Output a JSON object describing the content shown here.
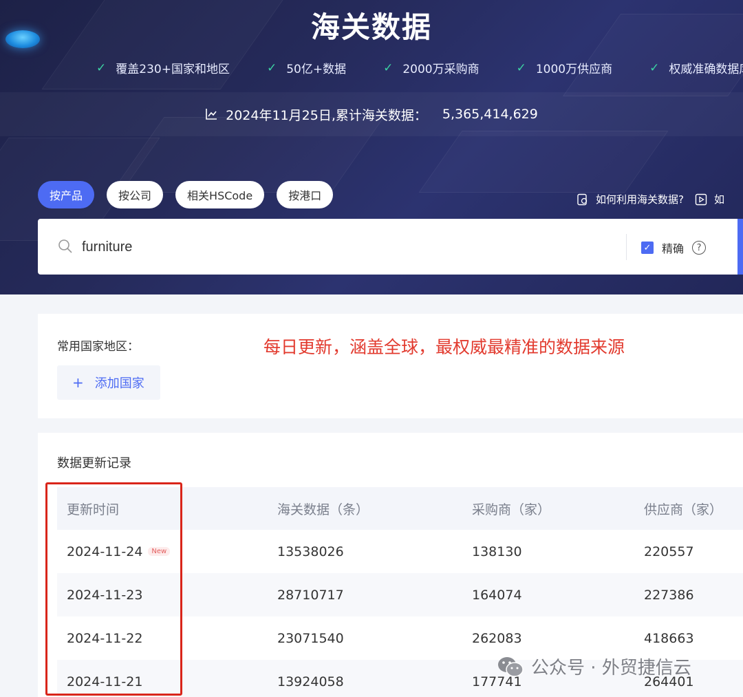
{
  "header": {
    "title": "海关数据",
    "features": [
      "覆盖230+国家和地区",
      "50亿+数据",
      "2000万采购商",
      "1000万供应商",
      "权威准确数据库"
    ],
    "stat_label": "2024年11月25日,累计海关数据：",
    "stat_value": "5,365,414,629"
  },
  "tabs": [
    "按产品",
    "按公司",
    "相关HSCode",
    "按港口"
  ],
  "help_links": [
    "如何利用海关数据?",
    "如"
  ],
  "search": {
    "value": "furniture",
    "exact_label": "精确",
    "help_glyph": "?"
  },
  "countries_card": {
    "label": "常用国家地区：",
    "add_label": "添加国家",
    "promo": "每日更新，涵盖全球，最权威最精准的数据来源"
  },
  "records": {
    "title": "数据更新记录",
    "columns": [
      "更新时间",
      "海关数据（条）",
      "采购商（家）",
      "供应商（家）"
    ],
    "rows": [
      {
        "date": "2024-11-24",
        "customs": "13538026",
        "buyers": "138130",
        "suppliers": "220557",
        "badge": "New"
      },
      {
        "date": "2024-11-23",
        "customs": "28710717",
        "buyers": "164074",
        "suppliers": "227386"
      },
      {
        "date": "2024-11-22",
        "customs": "23071540",
        "buyers": "262083",
        "suppliers": "418663"
      },
      {
        "date": "2024-11-21",
        "customs": "13924058",
        "buyers": "177741",
        "suppliers": "264401"
      }
    ]
  },
  "watermark": "公众号 · 外贸捷信云",
  "colors": {
    "primary": "#4d6bf3",
    "hero_bg": "#252a5a",
    "check": "#3cd3a3",
    "promo_red": "#e23a2e",
    "highlight_red": "#d9251a"
  }
}
